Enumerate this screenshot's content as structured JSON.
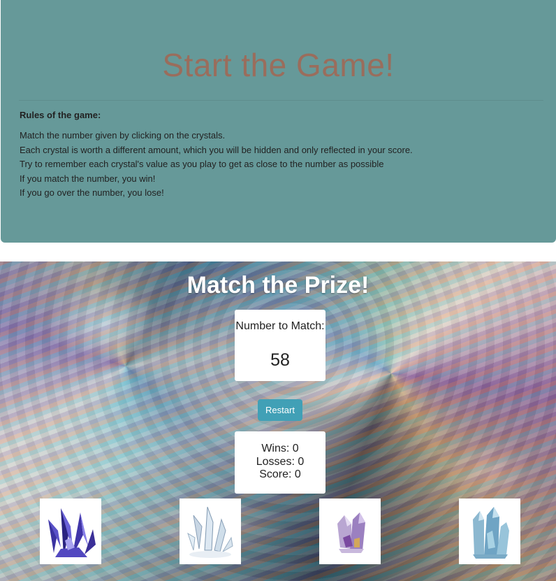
{
  "header": {
    "title": "Start the Game!",
    "rules_heading": "Rules of the game:",
    "rules": [
      "Match the number given by clicking on the crystals.",
      "Each crystal is worth a different amount, which you will be hidden and only reflected in your score.",
      "Try to remember each crystal's value as you play to get as close to the number as possible",
      "If you match the number, you win!",
      "If you go over the number, you lose!"
    ]
  },
  "game": {
    "title": "Match the Prize!",
    "target_label": "Number to Match:",
    "target_value": "58",
    "restart_label": "Restart",
    "stats": {
      "wins": "Wins: 0",
      "losses": "Losses: 0",
      "score": "Score: 0"
    },
    "crystals": [
      {
        "icon": "blue-crystal-icon",
        "color": "#4a3fb0"
      },
      {
        "icon": "clear-crystal-icon",
        "color": "#b8c8d8"
      },
      {
        "icon": "amethyst-crystal-icon",
        "color": "#9a7ab8"
      },
      {
        "icon": "aqua-crystal-icon",
        "color": "#7fb0c8"
      }
    ]
  }
}
